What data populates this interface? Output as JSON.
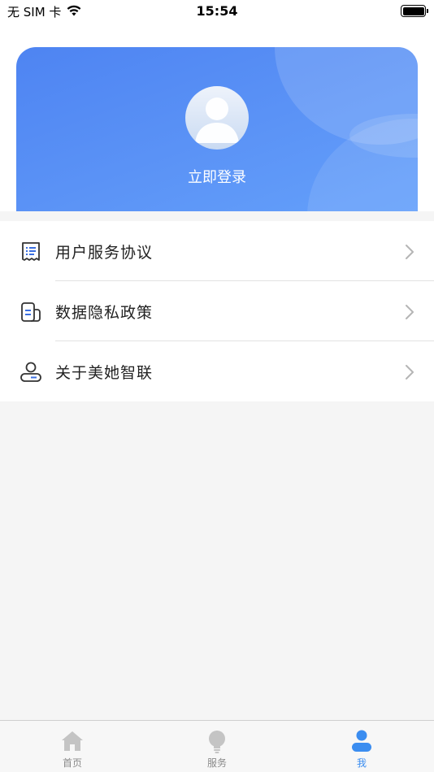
{
  "status_bar": {
    "carrier": "无 SIM 卡",
    "time": "15:54"
  },
  "profile": {
    "login_label": "立即登录"
  },
  "menu": {
    "items": [
      {
        "label": "用户服务协议",
        "icon": "receipt-icon"
      },
      {
        "label": "数据隐私政策",
        "icon": "document-icon"
      },
      {
        "label": "关于美她智联",
        "icon": "user-icon"
      }
    ]
  },
  "tab_bar": {
    "tabs": [
      {
        "label": "首页",
        "icon": "home-icon",
        "active": false
      },
      {
        "label": "服务",
        "icon": "lightbulb-icon",
        "active": false
      },
      {
        "label": "我",
        "icon": "person-icon",
        "active": true
      }
    ]
  },
  "colors": {
    "accent": "#3b8df0",
    "card_start": "#4e84f2",
    "card_end": "#64a0fb"
  }
}
